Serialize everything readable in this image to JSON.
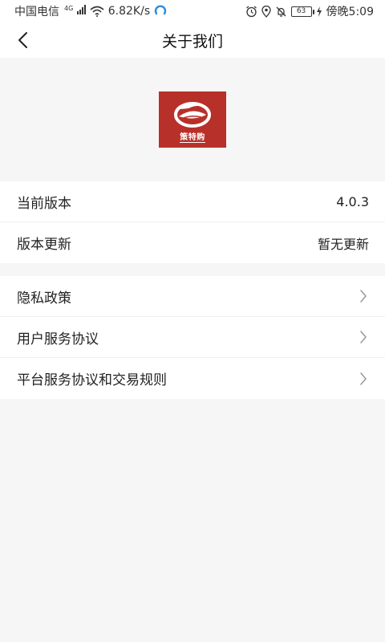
{
  "status_bar": {
    "carrier": "中国电信",
    "network_type": "4G",
    "speed": "6.82K/s",
    "battery": "63",
    "time": "傍晚5:09"
  },
  "nav": {
    "title": "关于我们"
  },
  "logo": {
    "text": "策特购",
    "color": "#b8302a"
  },
  "version_info": [
    {
      "label": "当前版本",
      "value": "4.0.3"
    },
    {
      "label": "版本更新",
      "value": "暂无更新"
    }
  ],
  "links": [
    {
      "label": "隐私政策"
    },
    {
      "label": "用户服务协议"
    },
    {
      "label": "平台服务协议和交易规则"
    }
  ]
}
